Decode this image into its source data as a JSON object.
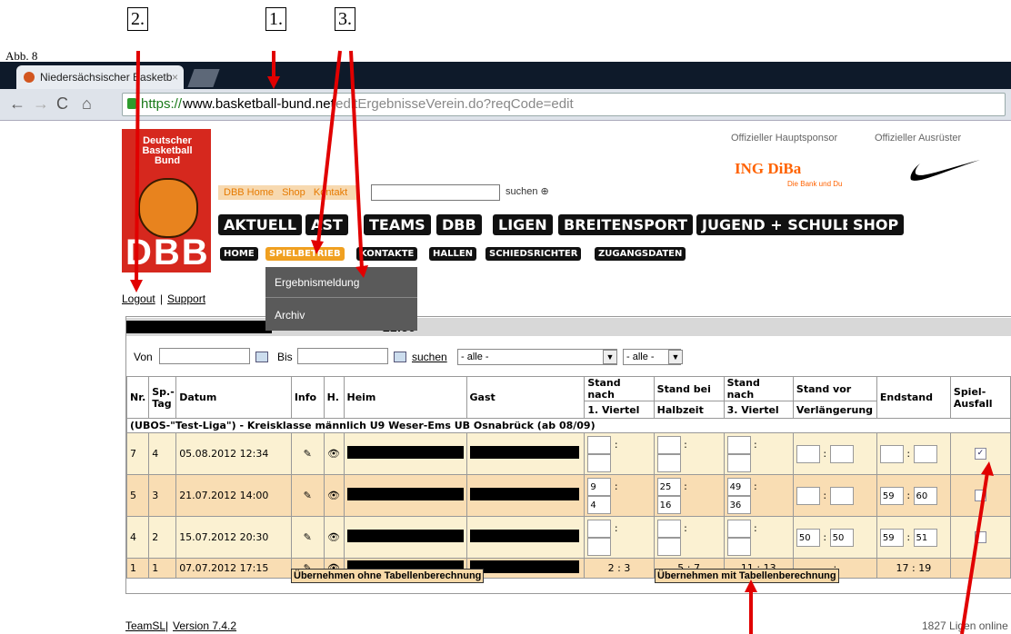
{
  "annotations": {
    "fig": "Abb. 8",
    "a1": "1.",
    "a2": "2.",
    "a3": "3."
  },
  "browser": {
    "tab_title": "Niedersächsischer Basketb",
    "tab_close": "×",
    "url_scheme": "https://",
    "url_host": "www.basketball-bund.net",
    "url_path": "/editErgebnisseVerein.do?reqCode=edit"
  },
  "site": {
    "logo_text": "Deutscher Basketball Bund",
    "logo_mark": "DBB",
    "top_links": [
      "DBB Home",
      "Shop",
      "Kontakt"
    ],
    "search_label": "suchen",
    "sponsor_main": "Offizieller Hauptsponsor",
    "sponsor_outfitter": "Offizieller Ausrüster",
    "ing": "ING DiBa",
    "ing_sub": "Die Bank und Du",
    "main_nav": [
      "AKTUELL",
      "AST",
      "TEAMS",
      "DBB",
      "LIGEN",
      "BREITENSPORT",
      "JUGEND + SCHULE",
      "SHOP"
    ],
    "sub_nav": [
      "HOME",
      "SPIELBETRIEB",
      "KONTAKTE",
      "HALLEN",
      "SCHIEDSRICHTER",
      "ZUGANGSDATEN"
    ],
    "dropdown": [
      "Ergebnismeldung",
      "Archiv"
    ],
    "logout": "Logout",
    "support": "Support",
    "sep": "|"
  },
  "panel": {
    "heading_suffix": "21:56",
    "filter": {
      "von": "Von",
      "bis": "Bis",
      "suchen": "suchen",
      "select1": "- alle -",
      "select2": "- alle -"
    },
    "headers": {
      "nr": "Nr.",
      "sptag": "Sp.-Tag",
      "datum": "Datum",
      "info": "Info",
      "h": "H.",
      "heim": "Heim",
      "gast": "Gast",
      "v1a": "Stand nach",
      "v1b": "1. Viertel",
      "hza": "Stand bei",
      "hzb": "Halbzeit",
      "v3a": "Stand nach",
      "v3b": "3. Viertel",
      "vla": "Stand vor",
      "vlb": "Verlängerung",
      "end": "Endstand",
      "ausfall": "Spiel-Ausfall"
    },
    "league": "(UBOS-\"Test-Liga\") - Kreisklasse männlich U9 Weser-Ems UB Osnabrück (ab 08/09)",
    "rows": [
      {
        "nr": "7",
        "tag": "4",
        "datum": "05.08.2012 12:34",
        "v1": [
          "",
          ""
        ],
        "hz": [
          "",
          ""
        ],
        "v3": [
          "",
          ""
        ],
        "vl": [
          "",
          ""
        ],
        "end": [
          "",
          ""
        ],
        "ausfall": "✓"
      },
      {
        "nr": "5",
        "tag": "3",
        "datum": "21.07.2012 14:00",
        "v1": [
          "9",
          "4"
        ],
        "hz": [
          "25",
          "16"
        ],
        "v3": [
          "49",
          "36"
        ],
        "vl": [
          "",
          ""
        ],
        "end": [
          "59",
          "60"
        ],
        "ausfall": ""
      },
      {
        "nr": "4",
        "tag": "2",
        "datum": "15.07.2012 20:30",
        "v1": [
          "",
          ""
        ],
        "hz": [
          "",
          ""
        ],
        "v3": [
          "",
          ""
        ],
        "vl": [
          "50",
          "50"
        ],
        "end": [
          "59",
          "51"
        ],
        "ausfall": ""
      },
      {
        "nr": "1",
        "tag": "1",
        "datum": "07.07.2012 17:15",
        "v1": "2 : 3",
        "hz": "5 : 7",
        "v3": "11 : 13",
        "vl": ":",
        "end": "17 : 19",
        "ausfall": ""
      }
    ],
    "btn_ohne": "Übernehmen ohne Tabellenberechnung",
    "btn_mit": "Übernehmen mit Tabellenberechnung"
  },
  "footer": {
    "teamsl": "TeamSL",
    "version": "Version 7.4.2",
    "ligen": "1827 Ligen online"
  }
}
